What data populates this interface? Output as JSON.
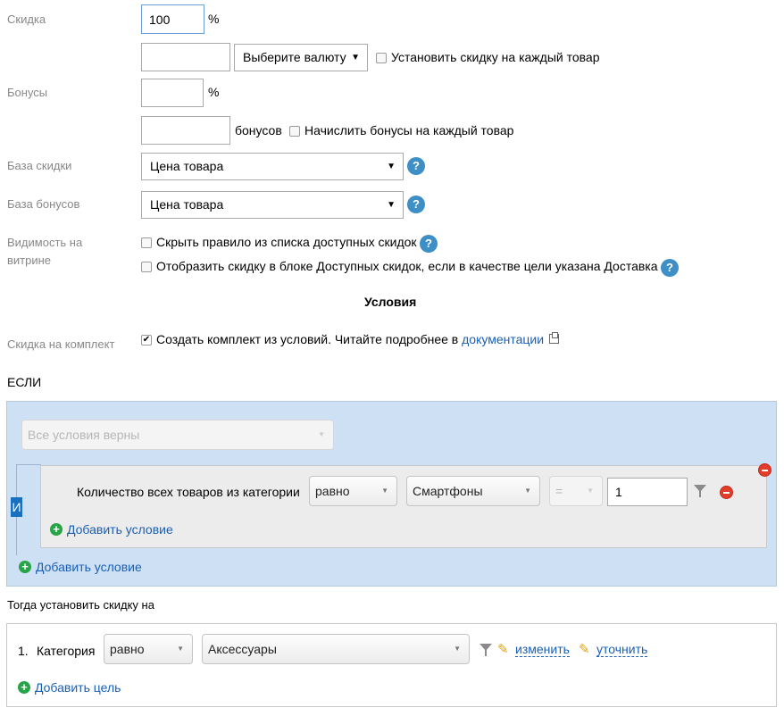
{
  "discount": {
    "label": "Скидка",
    "percent_value": "100",
    "percent_unit": "%"
  },
  "discount_currency": {
    "amount_value": "",
    "currency_select": "Выберите валюту",
    "per_item_label": "Установить скидку на каждый товар"
  },
  "bonuses": {
    "label": "Бонусы",
    "percent_value": "",
    "percent_unit": "%"
  },
  "bonuses_amount": {
    "amount_value": "",
    "unit": "бонусов",
    "per_item_label": "Начислить бонусы на каждый товар"
  },
  "discount_base": {
    "label": "База скидки",
    "value": "Цена товара"
  },
  "bonus_base": {
    "label": "База бонусов",
    "value": "Цена товара"
  },
  "visibility": {
    "label_line1": "Видимость на",
    "label_line2": "витрине",
    "hide_rule_label": "Скрыть правило из списка доступных скидок",
    "show_delivery_label": "Отобразить скидку в блоке Доступных скидок, если в качестве цели указана Доставка"
  },
  "conditions": {
    "title": "Условия",
    "kit_label": "Скидка на комплект",
    "kit_checkbox_text": "Создать комплект из условий. Читайте подробнее в ",
    "kit_doc_link": "документации",
    "if_label": "ЕСЛИ",
    "all_conditions_select": "Все условия верны",
    "and_label": "И",
    "condition_text": "Количество всех товаров из категории",
    "condition_operator": "равно",
    "condition_category": "Смартфоны",
    "condition_compare": "=",
    "condition_value": "1",
    "add_inner_condition": "Добавить условие",
    "add_condition": "Добавить условие"
  },
  "targets": {
    "title": "Тогда установить скидку на",
    "row_number": "1.",
    "row_label": "Категория",
    "row_operator": "равно",
    "row_value": "Аксессуары",
    "edit_link": "изменить",
    "refine_link": "уточнить",
    "add_target": "Добавить цель"
  },
  "colors": {
    "conditions_panel_bg": "#cde0f4",
    "help_icon": "#3d8fc6",
    "add_icon": "#27a348",
    "remove_icon": "#e23d2b",
    "link": "#1a5fb4"
  }
}
